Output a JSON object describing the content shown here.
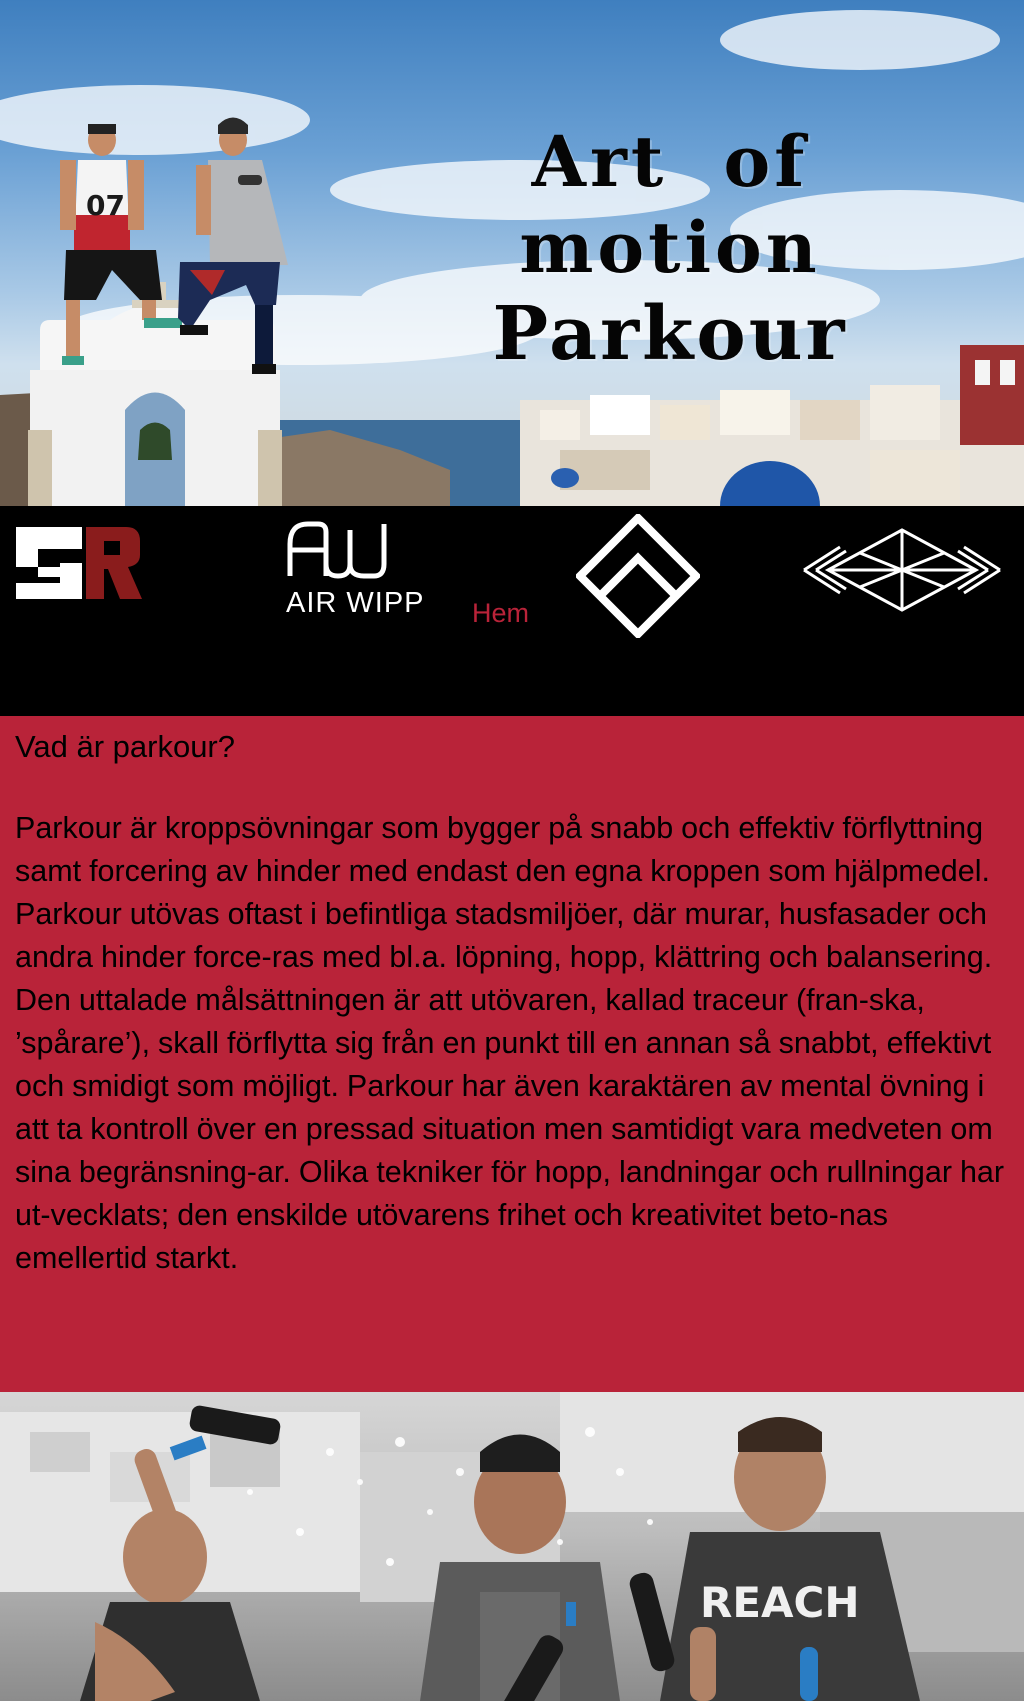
{
  "hero": {
    "title_line1": "Art of motion",
    "title_line2": "Parkour",
    "shirt_number": "07"
  },
  "nav": {
    "logos": [
      {
        "name": "gr-logo"
      },
      {
        "name": "air-wipp-logo",
        "text": "AIR WIPP"
      },
      {
        "name": "diamond-outline-logo"
      },
      {
        "name": "crystal-diamond-logo"
      }
    ],
    "home_label": "Hem"
  },
  "content": {
    "heading": "Vad är parkour?",
    "body": "Parkour är kroppsövningar som bygger på snabb och effektiv förflyttning samt forcering av hinder med endast den egna kroppen som hjälpmedel. Parkour utövas oftast i befintliga stadsmiljöer, där murar, husfasader och andra hinder force-ras med bl.a. löpning, hopp, klättring och balansering. Den uttalade målsättningen är att utövaren, kallad traceur (fran-ska, ’spårare’), skall förflytta sig från en punkt till en annan så snabbt, effektivt och smidigt som möjligt. Parkour har även karaktären av mental övning i att ta kontroll över en pressad situation men samtidigt vara medveten om sina begränsning-ar. Olika tekniker för hopp, landningar och rullningar har ut-vecklats; den enskilde utövarens frihet och kreativitet beto-nas emellertid starkt."
  },
  "bottom_photo": {
    "shirt_text": "REACH"
  },
  "colors": {
    "accent_red": "#b92339",
    "nav_background": "#000000",
    "logo_dark_red": "#8a1c1c"
  }
}
